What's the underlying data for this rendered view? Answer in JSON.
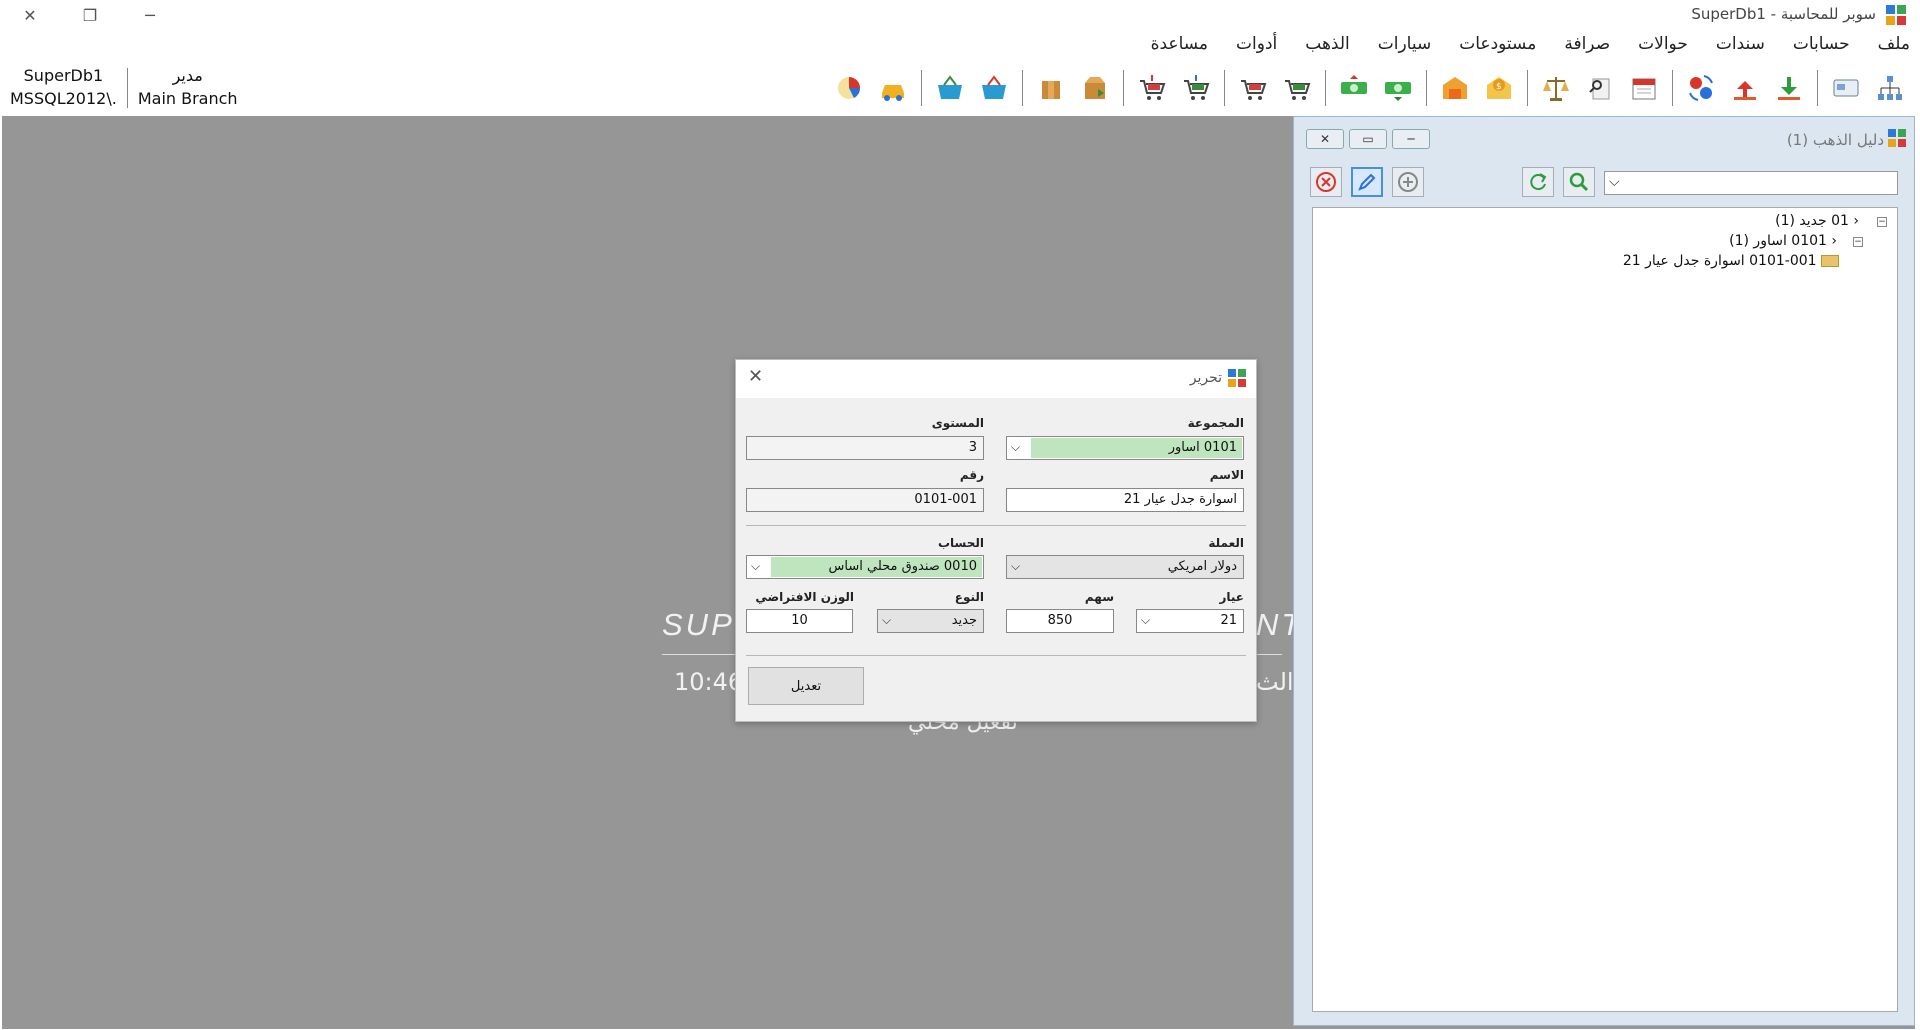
{
  "window": {
    "title": "سوبر للمحاسبة - SuperDb1"
  },
  "menu": [
    "ملف",
    "حسابات",
    "سندات",
    "حوالات",
    "صرافة",
    "مستودعات",
    "سيارات",
    "الذهب",
    "أدوات",
    "مساعدة"
  ],
  "session": {
    "db_name": "SuperDb1",
    "server": "MSSQL2012\\.",
    "user": "مدير",
    "branch": "Main Branch"
  },
  "toolbar_icons": [
    "org-chart-icon",
    "card-icon",
    "arrow-down-icon",
    "arrow-up-icon",
    "exchange-icon",
    "calendar-icon",
    "search-doc-icon",
    "scale-icon",
    "coin-envelope-icon",
    "warehouse-icon",
    "cash-in-icon",
    "cash-out-icon",
    "cart-1-icon",
    "cart-2-icon",
    "cart-3-icon",
    "cart-4-icon",
    "box-transfer-icon",
    "box-icon",
    "basket-1-icon",
    "basket-2-icon",
    "car-icon",
    "chart-icon"
  ],
  "splash": {
    "time": "10:46",
    "day_fragment": "الث",
    "mode": "تفعيل محلي"
  },
  "gold_panel": {
    "title": "دليل الذهب (1)",
    "tree": [
      {
        "label": "01 جديد (1)",
        "level": 0
      },
      {
        "label": "0101 اساور (1)",
        "level": 1
      },
      {
        "label": "0101-001 اسوارة جدل عيار 21",
        "level": 2
      }
    ]
  },
  "dialog": {
    "title": "تحرير",
    "group_label": "المجموعة",
    "group_value": "0101 اساور",
    "level_label": "المستوى",
    "level_value": "3",
    "name_label": "الاسم",
    "name_value": "اسوارة جدل عيار 21",
    "number_label": "رقم",
    "number_value": "0101-001",
    "currency_label": "العملة",
    "currency_value": "دولار امريكي",
    "account_label": "الحساب",
    "account_value": "0010 صندوق محلي اساس",
    "karat_label": "عيار",
    "karat_value": "21",
    "share_label": "سهم",
    "share_value": "850",
    "type_label": "النوع",
    "type_value": "جديد",
    "weight_label": "الوزن الافتراضي",
    "weight_value": "10",
    "submit_label": "تعديل"
  }
}
